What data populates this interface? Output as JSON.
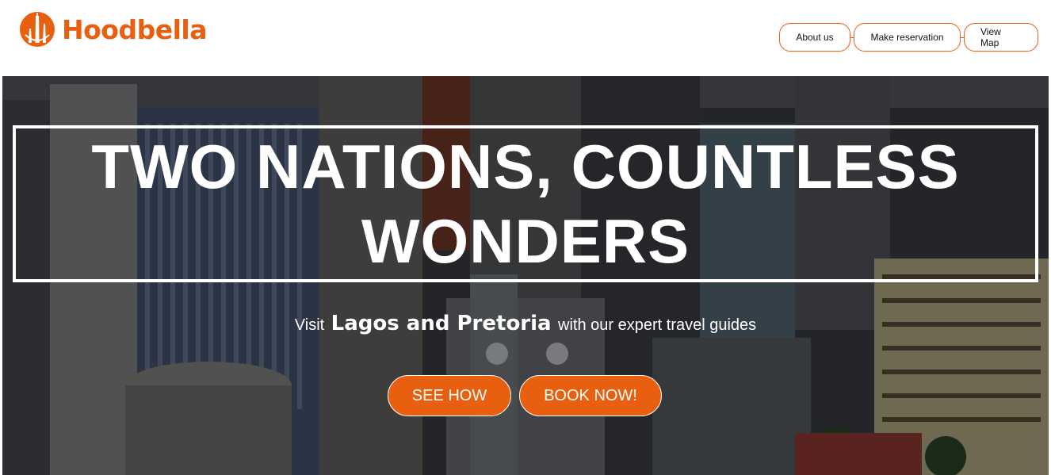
{
  "brand": {
    "name": "Hoodbella",
    "color": "#e8600f",
    "logo_icon": "tower-skyline-icon"
  },
  "nav": {
    "items": [
      {
        "label": "About us"
      },
      {
        "label": "Make reservation"
      },
      {
        "label": "View Map"
      }
    ]
  },
  "hero": {
    "background": "city-skyline-photo",
    "headline_line1": "TWO NATIONS, COUNTLESS",
    "headline_line2": "WONDERS",
    "tagline_prefix": "Visit",
    "tagline_cities": "Lagos and Pretoria",
    "tagline_suffix": "with our expert travel guides",
    "cta": {
      "see_how": "SEE HOW",
      "book_now": "BOOK NOW!"
    }
  }
}
